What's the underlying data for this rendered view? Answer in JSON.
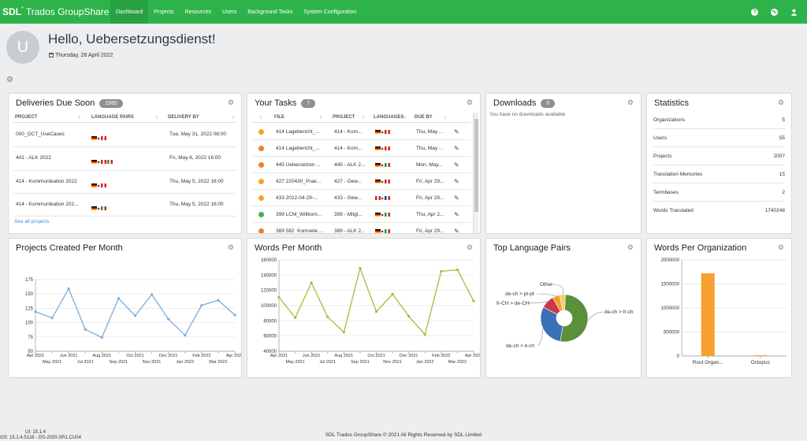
{
  "header": {
    "logo_brand": "SDL",
    "logo_product": "Trados GroupShare",
    "nav": [
      "Dashboard",
      "Projects",
      "Resources",
      "Users",
      "Background Tasks",
      "System Configuration"
    ],
    "active_nav": "Dashboard",
    "icons": [
      "help-icon",
      "globe-icon",
      "user-icon"
    ]
  },
  "profile": {
    "avatar_initial": "U",
    "greeting": "Hello, Uebersetzungsdienst!",
    "date": "Thursday, 28 April 2022"
  },
  "deliveries": {
    "title": "Deliveries Due Soon",
    "count": "1985",
    "columns": [
      "PROJECT",
      "LANGUAGE PAIRS",
      "DELIVERY BY"
    ],
    "rows": [
      {
        "project": "000_OCT_UseCases",
        "delivery": "Tue, May 31, 2022 08:00"
      },
      {
        "project": "441 - ALK 2022",
        "delivery": "Fri, May 6, 2022 16:00"
      },
      {
        "project": "414 - Kommunikation 2022",
        "delivery": "Thu, May 5, 2022 16:00"
      },
      {
        "project": "414 - Kommunikation 202...",
        "delivery": "Thu, May 5, 2022 16:00"
      }
    ],
    "see_all": "See all projects"
  },
  "tasks": {
    "title": "Your Tasks",
    "count": "7",
    "columns": [
      "FILE",
      "PROJECT",
      "LANGUAGES",
      "DUE BY"
    ],
    "rows": [
      {
        "file": "414 Lagebericht_...",
        "project": "414 - Kom...",
        "due": "Thu, May ...",
        "status_color": "#f5a623"
      },
      {
        "file": "414 Lagebericht_...",
        "project": "414 - Kom...",
        "due": "Thu, May ...",
        "status_color": "#f07f2a"
      },
      {
        "file": "445 Uebersetzen ...",
        "project": "445 - ALK 2...",
        "due": "Mon, May...",
        "status_color": "#f07f2a"
      },
      {
        "file": "427 220430_Prae...",
        "project": "427 - Gew...",
        "due": "Fri, Apr 29...",
        "status_color": "#f5a623"
      },
      {
        "file": "433 2022-04-29-...",
        "project": "433 - Gew...",
        "due": "Fri, Apr 29...",
        "status_color": "#f5a623"
      },
      {
        "file": "399 LCM_Willkom...",
        "project": "399 - Mitgl...",
        "due": "Thu, Apr 2...",
        "status_color": "#3cb34a"
      },
      {
        "file": "389 582_Komoete ...",
        "project": "389 - ALK 2...",
        "due": "Fri, Apr 29...",
        "status_color": "#f07f2a"
      }
    ]
  },
  "downloads": {
    "title": "Downloads",
    "count": "0",
    "empty": "You have no downloads available"
  },
  "statistics": {
    "title": "Statistics",
    "rows": [
      {
        "label": "Organizations",
        "value": "5"
      },
      {
        "label": "Users",
        "value": "55"
      },
      {
        "label": "Projects",
        "value": "2007"
      },
      {
        "label": "Translation Memories",
        "value": "15"
      },
      {
        "label": "Termbases",
        "value": "2"
      },
      {
        "label": "Words Translated",
        "value": "1740248"
      }
    ]
  },
  "chart_data": [
    {
      "type": "line",
      "title": "Projects Created Per Month",
      "x": [
        "Apr 2021",
        "May 2021",
        "Jun 2021",
        "Jul 2021",
        "Aug 2021",
        "Sep 2021",
        "Oct 2021",
        "Nov 2021",
        "Dec 2021",
        "Jan 2022",
        "Feb 2022",
        "Mar 2022",
        "Apr 2022"
      ],
      "values": [
        119,
        108,
        159,
        88,
        74,
        142,
        112,
        149,
        106,
        78,
        130,
        139,
        113
      ],
      "yticks": [
        50,
        75,
        100,
        125,
        150,
        175
      ],
      "ylim": [
        50,
        175
      ],
      "color": "#7aaedc"
    },
    {
      "type": "line",
      "title": "Words Per Month",
      "x": [
        "Apr 2021",
        "May 2021",
        "Jun 2021",
        "Jul 2021",
        "Aug 2021",
        "Sep 2021",
        "Oct 2021",
        "Nov 2021",
        "Dec 2021",
        "Jan 2022",
        "Feb 2022",
        "Mar 2022",
        "Apr 2022"
      ],
      "values": [
        111000,
        84000,
        130000,
        85000,
        65000,
        149000,
        92000,
        115000,
        86000,
        62000,
        145000,
        147000,
        106000
      ],
      "yticks": [
        40000,
        60000,
        80000,
        100000,
        120000,
        140000,
        160000
      ],
      "ylim": [
        40000,
        160000
      ],
      "color": "#a2bd3a"
    },
    {
      "type": "pie",
      "title": "Top Language Pairs",
      "labels": [
        "de-ch > fr-ch",
        "de-ch > it-ch",
        "fr-CH > de-CH",
        "de-ch > pt-pt",
        "Other"
      ],
      "values": [
        52,
        30,
        9,
        5,
        4
      ],
      "colors": [
        "#5a8f3c",
        "#3b6fb6",
        "#c8384a",
        "#f0a030",
        "#f5d06a"
      ]
    },
    {
      "type": "bar",
      "title": "Words Per Organization",
      "categories": [
        "Root Organ...",
        "Octopus"
      ],
      "values": [
        1720000,
        15000
      ],
      "yticks": [
        0,
        500000,
        1000000,
        1500000,
        2000000
      ],
      "ylim": [
        0,
        2000000
      ],
      "color": "#f5a030"
    }
  ],
  "footer": {
    "ui_version": "UI: 15.1.4",
    "gs_version": "GS: 15.1.4.5118 - GS-2020.SR1.CU04",
    "copyright": "SDL Trados GroupShare © 2021 All Rights Reserved by SDL Limited"
  }
}
